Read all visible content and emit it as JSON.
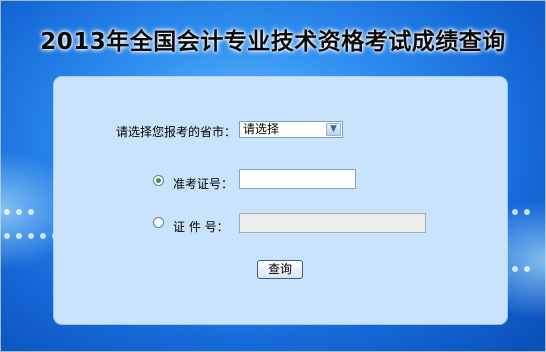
{
  "title": "2013年全国会计专业技术资格考试成绩查询",
  "form": {
    "province_label": "请选择您报考的省市：",
    "province_value": "请选择",
    "admission_label": "准考证号：",
    "admission_value": "",
    "id_label": "证 件 号：",
    "id_value": "",
    "query_button": "查询"
  },
  "colors": {
    "background": "#1f7fe6",
    "panel": "#c8e3fb",
    "radio_checked": "#2f9a2f"
  }
}
